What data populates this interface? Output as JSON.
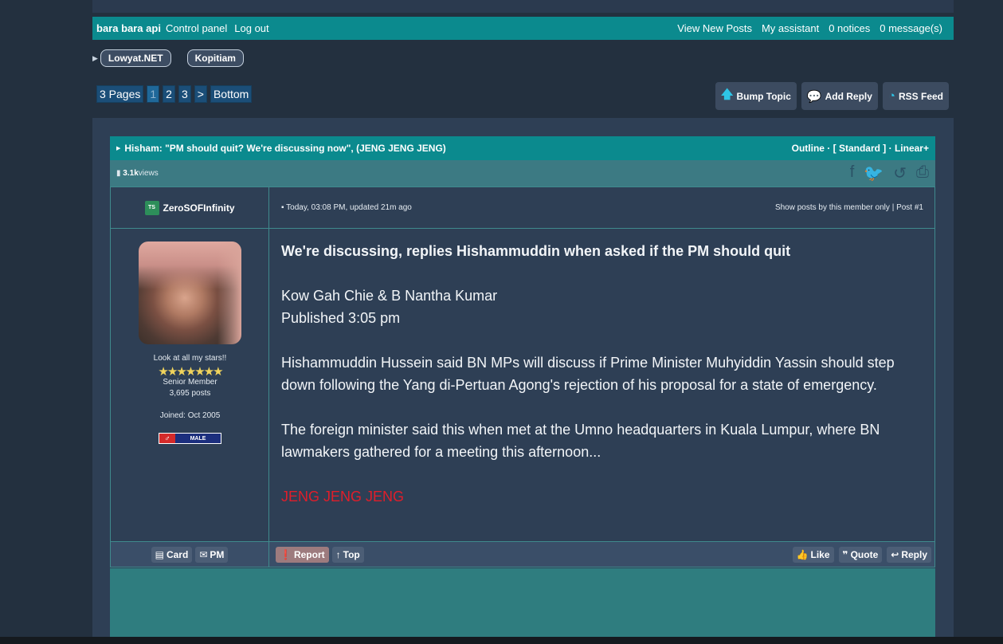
{
  "userbar": {
    "username": "bara bara api",
    "control_panel": "Control panel",
    "logout": "Log out",
    "view_new_posts": "View New Posts",
    "my_assistant": "My assistant",
    "notices": "0 notices",
    "messages": "0 message(s)"
  },
  "breadcrumbs": [
    "Lowyat.NET",
    "Kopitiam"
  ],
  "pager": {
    "pages_label": "3 Pages",
    "pages": [
      "1",
      "2",
      "3"
    ],
    "next": ">",
    "bottom": "Bottom"
  },
  "actions": {
    "bump": "Bump Topic",
    "add_reply": "Add Reply",
    "rss": "RSS Feed"
  },
  "topic": {
    "title": "Hisham: \"PM should quit? We're discussing now\", (JENG JENG JENG)",
    "modes": "Outline · [ Standard ] · Linear+",
    "views_count": "3.1k",
    "views_label": " views"
  },
  "post": {
    "author_initials": "TS",
    "author": "ZeroSOFInfinity",
    "date": "Today, 03:08 PM, updated 21m ago",
    "show_posts": "Show posts by this member only",
    "post_num": "Post #1",
    "tagline": "Look at all my stars!!",
    "stars": "★★★★★★★",
    "rank": "Senior Member",
    "post_count": "3,695 posts",
    "joined": "Joined: Oct 2005",
    "gender_symbol": "♂",
    "gender": "MALE",
    "headline": "We're discussing, replies Hishammuddin when asked if the PM should quit",
    "byline": "Kow Gah Chie & B Nantha Kumar",
    "published": "Published 3:05 pm",
    "para1": "Hishammuddin Hussein said BN MPs will discuss if Prime Minister Muhyiddin Yassin should step down following the Yang di-Pertuan Agong's rejection of his proposal for a state of emergency.",
    "para2": "The foreign minister said this when met at the Umno headquarters in Kuala Lumpur, where BN lawmakers gathered for a meeting this afternoon...",
    "jeng": "JENG JENG JENG"
  },
  "footer": {
    "card": "Card",
    "pm": "PM",
    "report": "Report",
    "top": "Top",
    "like": "Like",
    "quote": "Quote",
    "reply": "Reply"
  },
  "colors": {
    "teal": "#0b8a8e",
    "background": "#23303f",
    "panel": "#2e3f55",
    "accent_icon": "#2ec5e6",
    "red_text": "#e01e2a"
  }
}
